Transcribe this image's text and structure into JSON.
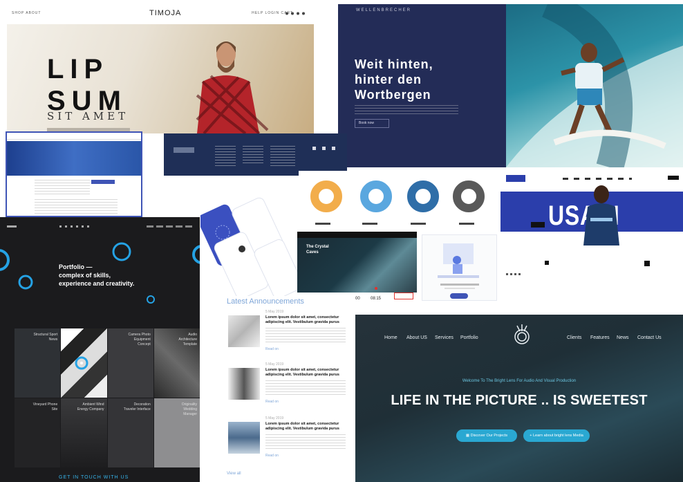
{
  "timoja": {
    "nav_left": "SHOP   ABOUT",
    "brand": "TIMOJA",
    "nav_right": "HELP   LOGIN   CART",
    "headline_line1": "LIP",
    "headline_line2": "SUM",
    "subtitle": "SIT AMET"
  },
  "surf": {
    "logo": "WELLENBRECHER",
    "headline_line1": "Weit hinten,",
    "headline_line2": "hinter den",
    "headline_line3": "Wortbergen",
    "button": "Book now"
  },
  "bolt": {
    "name": "USAIN BOLT"
  },
  "portfolio": {
    "title_line1": "Portfolio —",
    "title_line2": "complex of skills,",
    "title_line3": "experience and creativity.",
    "tiles": [
      {
        "label": "Structural Sport News"
      },
      {
        "label": ""
      },
      {
        "label": "Camera Photo Equipment Concept"
      },
      {
        "label": "Audio Architecture Template"
      },
      {
        "label": "Vineyard Phone Site"
      },
      {
        "label": "Ambient Wind Energy Company"
      },
      {
        "label": "Decoration Traveler Interface"
      },
      {
        "label": "Originality Wedding Manager"
      }
    ],
    "footer": "GET IN TOUCH WITH US"
  },
  "crystal": {
    "title_line1": "The Crystal",
    "title_line2": "Caves",
    "stats": [
      "15",
      "00",
      "08:15"
    ]
  },
  "blog": {
    "heading": "Latest Announcements",
    "items": [
      {
        "date": "5 May 2019",
        "title": "Lorem ipsum dolor sit amet, consectetur adipiscing elit. Vestibulum gravida purus",
        "more": "Read on"
      },
      {
        "date": "5 May 2019",
        "title": "Lorem ipsum dolor sit amet, consectetur adipiscing elit. Vestibulum gravida purus",
        "more": "Read on"
      },
      {
        "date": "5 May 2019",
        "title": "Lorem ipsum dolor sit amet, consectetur adipiscing elit. Vestibulum gravida purus",
        "more": "Read on"
      }
    ],
    "view_all": "View all"
  },
  "lens": {
    "nav_left": [
      "Home",
      "About US",
      "Services",
      "Portfolio"
    ],
    "nav_right": [
      "Clients",
      "Features",
      "News",
      "Contact Us"
    ],
    "welcome": "Welcome To The Bright Lens For Audio And Visual Production",
    "headline": "LIFE IN THE PICTURE .. IS SWEETEST",
    "button_primary": "Discover Our Projects",
    "button_secondary": "Learn about bright lens Media"
  },
  "colors": {
    "bolt_blue": "#2b3eab",
    "surf_navy": "#232c57",
    "accent_cyan": "#2aa8d2",
    "portfolio_dark": "#1b1b1d",
    "donut_orange": "#f2ad4b",
    "donut_lightblue": "#5aa7df",
    "donut_blue": "#2f6ea8",
    "donut_gray": "#595959"
  }
}
